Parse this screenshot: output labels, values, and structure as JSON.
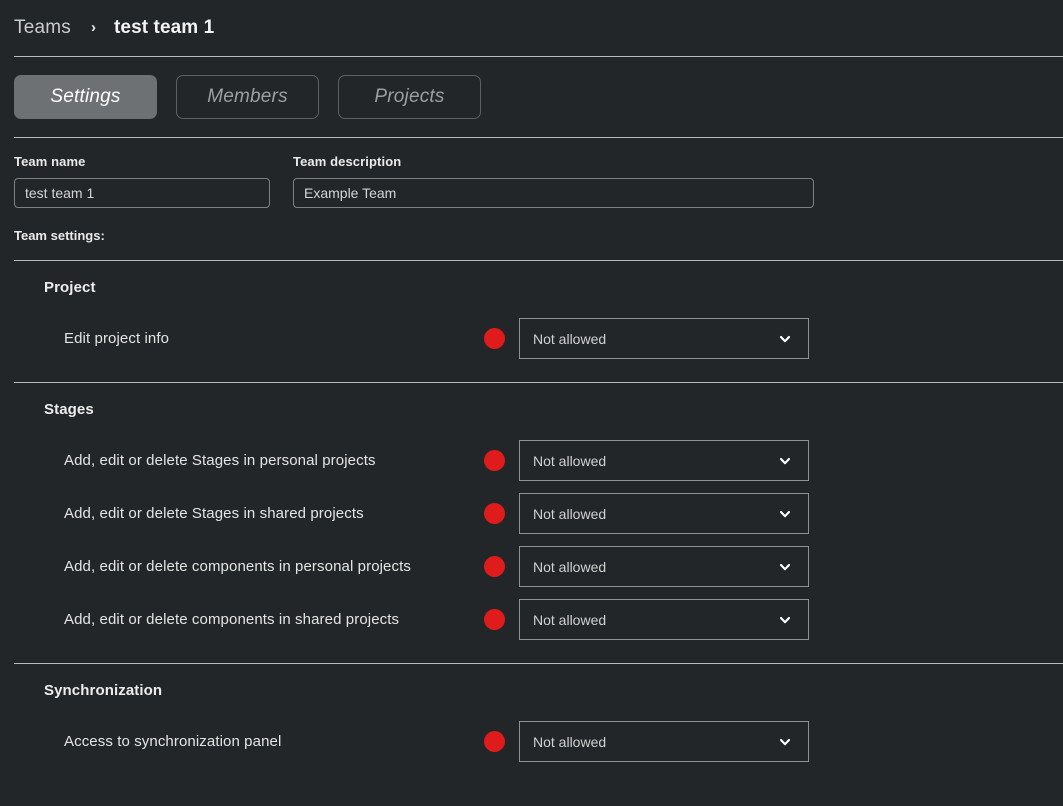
{
  "breadcrumb": {
    "root": "Teams",
    "separator_icon": "chevron-right-icon",
    "separator": "›",
    "current": "test team 1"
  },
  "tabs": [
    {
      "label": "Settings",
      "active": true
    },
    {
      "label": "Members",
      "active": false
    },
    {
      "label": "Projects",
      "active": false
    }
  ],
  "form": {
    "team_name": {
      "label": "Team name",
      "value": "test team 1"
    },
    "team_description": {
      "label": "Team description",
      "value": "Example Team"
    },
    "settings_label": "Team settings:"
  },
  "colors": {
    "background": "#232628",
    "divider": "#b9bcbd",
    "status_denied": "#e01b1b",
    "tab_active_bg": "#6e7173",
    "tab_inactive_text": "#9b9fa1",
    "border": "#8d9193"
  },
  "sections": [
    {
      "title": "Project",
      "rows": [
        {
          "label": "Edit project info",
          "status": "denied",
          "value": "Not allowed",
          "dropdown_icon": "chevron-down-icon"
        }
      ]
    },
    {
      "title": "Stages",
      "rows": [
        {
          "label": "Add, edit or delete Stages in personal projects",
          "status": "denied",
          "value": "Not allowed",
          "dropdown_icon": "chevron-down-icon"
        },
        {
          "label": "Add, edit or delete Stages in shared projects",
          "status": "denied",
          "value": "Not allowed",
          "dropdown_icon": "chevron-down-icon"
        },
        {
          "label": "Add, edit or delete components in personal projects",
          "status": "denied",
          "value": "Not allowed",
          "dropdown_icon": "chevron-down-icon"
        },
        {
          "label": "Add, edit or delete components in shared projects",
          "status": "denied",
          "value": "Not allowed",
          "dropdown_icon": "chevron-down-icon"
        }
      ]
    },
    {
      "title": "Synchronization",
      "rows": [
        {
          "label": "Access to synchronization panel",
          "status": "denied",
          "value": "Not allowed",
          "dropdown_icon": "chevron-down-icon"
        }
      ]
    }
  ]
}
